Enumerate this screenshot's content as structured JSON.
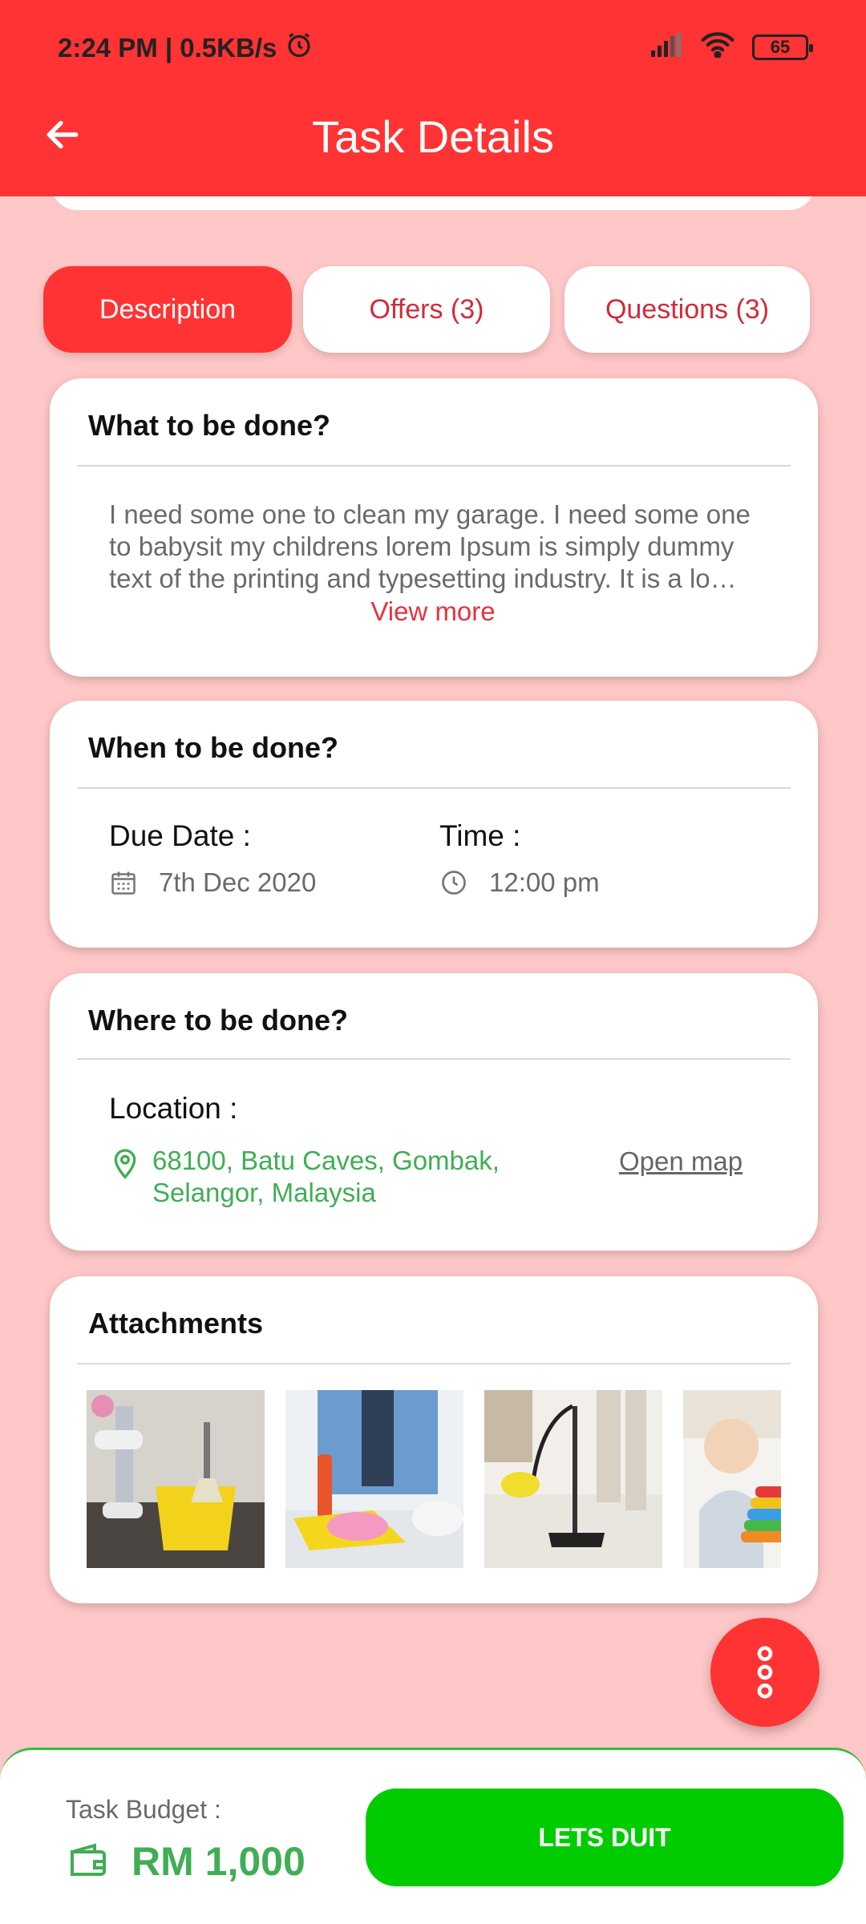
{
  "status_bar": {
    "time_net": "2:24 PM | 0.5KB/s",
    "battery": "65",
    "alarm_icon": "alarm-clock-icon",
    "signal_icon": "cell-signal-icon",
    "wifi_icon": "wifi-icon"
  },
  "header": {
    "title": "Task Details",
    "back_icon": "arrow-left-icon",
    "color": "#ff3333"
  },
  "tabs": [
    {
      "label": "Description",
      "active": true
    },
    {
      "label": "Offers (3)",
      "active": false
    },
    {
      "label": "Questions (3)",
      "active": false
    }
  ],
  "what": {
    "title": "What to be done?",
    "description": "I need some one to clean my garage. I need some one to babysit my childrens lorem Ipsum is simply dummy text of the printing and typesetting industry. It is a lo…",
    "view_more": "View more"
  },
  "when": {
    "title": "When to be done?",
    "due_label": "Due Date :",
    "due_value": "7th Dec 2020",
    "time_label": "Time :",
    "time_value": "12:00 pm",
    "calendar_icon": "calendar-icon",
    "clock_icon": "clock-icon"
  },
  "where": {
    "title": "Where to be done?",
    "location_label": "Location :",
    "location_line1": "68100, Batu Caves, Gombak,",
    "location_line2": "Selangor, Malaysia",
    "open_map": "Open map",
    "pin_icon": "location-pin-icon"
  },
  "attachments": {
    "title": "Attachments",
    "items": [
      "cleaning-bucket-image",
      "wiping-table-image",
      "vacuum-carpet-image",
      "baby-toys-image"
    ]
  },
  "fab": {
    "icon": "more-vertical-icon"
  },
  "bottom": {
    "budget_label": "Task Budget :",
    "budget_value": "RM 1,000",
    "wallet_icon": "wallet-icon",
    "cta_label": "LETS DUIT"
  },
  "colors": {
    "primary_red": "#ff3333",
    "page_bg": "#ffc7c7",
    "green": "#00cc00",
    "text_green": "#3fae54"
  }
}
